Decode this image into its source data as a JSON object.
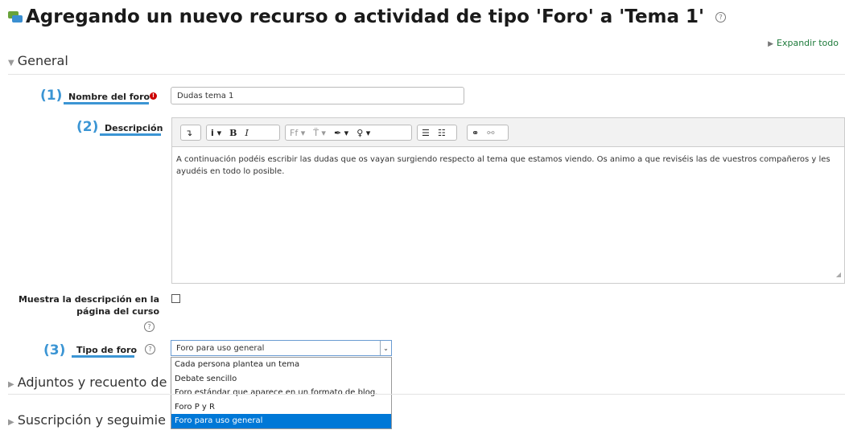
{
  "page": {
    "title": "Agregando un nuevo recurso o actividad de tipo 'Foro' a 'Tema 1'",
    "help": "?",
    "expand_all": "Expandir todo"
  },
  "sections": {
    "general": "General",
    "attachments": "Adjuntos y recuento de",
    "subscription": "Suscripción y seguimie"
  },
  "form": {
    "name": {
      "number": "(1)",
      "label": "Nombre del foro",
      "required_icon": "!",
      "value": "Dudas tema 1"
    },
    "description": {
      "number": "(2)",
      "label": "Descripción",
      "text": "A continuación podéis escribir las dudas que os vayan surgiendo respecto al tema que estamos viendo. Os animo a que reviséis las de vuestros compañeros y les ayudéis en todo lo posible."
    },
    "show_description": {
      "label_line1": "Muestra la descripción en la",
      "label_line2": "página del curso",
      "checked": false
    },
    "forum_type": {
      "number": "(3)",
      "label": "Tipo de foro",
      "selected": "Foro para uso general",
      "options": [
        "Cada persona plantea un tema",
        "Debate sencillo",
        "Foro estándar que aparece en un formato de blog.",
        "Foro P y R",
        "Foro para uso general"
      ],
      "highlighted_index": 4
    }
  },
  "toolbar": {
    "undo": "↴",
    "info": "i ▾",
    "bold": "B",
    "italic": "I",
    "font": "Ff ▾",
    "size": "T̈ ▾",
    "color": "✒ ▾",
    "bulb": "♀ ▾",
    "ul": "☰",
    "ol": "☷",
    "link": "⚭",
    "unlink": "⚯"
  },
  "colors": {
    "accent_blue": "#3b95d4",
    "link_green": "#1d7a3a",
    "required_red": "#cc0000",
    "selection_blue": "#0078d7"
  },
  "icons": {
    "title": "forum-icon",
    "help": "help-circle-icon",
    "required": "required-exclamation-icon",
    "section_open": "caret-down-icon",
    "section_closed": "caret-right-icon"
  }
}
